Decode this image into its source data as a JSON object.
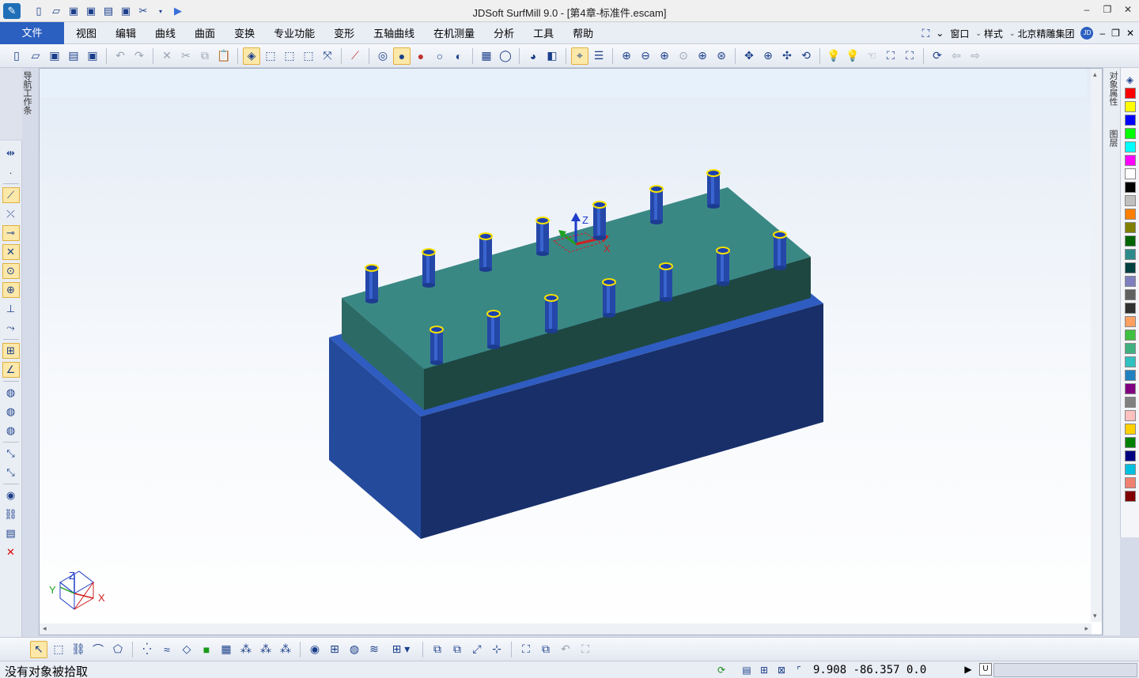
{
  "app": {
    "window_title": "JDSoft SurfMill 9.0 - [第4章-标准件.escam]"
  },
  "menu": {
    "file_label": "文件",
    "items": [
      "视图",
      "编辑",
      "曲线",
      "曲面",
      "变换",
      "专业功能",
      "变形",
      "五轴曲线",
      "在机测量",
      "分析",
      "工具",
      "帮助"
    ],
    "window_label": "窗口",
    "style_label": "样式",
    "company_label": "北京精雕集团",
    "user_badge": "JD"
  },
  "panels": {
    "nav_label": "导航工作条",
    "right_tab_properties": "对象属性",
    "right_tab_layers": "图层"
  },
  "viewport": {
    "axis_labels": {
      "x": "X",
      "y": "Y",
      "z": "Z"
    }
  },
  "palette": {
    "colors": [
      "#ff0000",
      "#ffff00",
      "#0000ff",
      "#00ff00",
      "#00ffff",
      "#ff00ff",
      "#ffffff",
      "#000000",
      "#c0c0c0",
      "#ff7f00",
      "#808000",
      "#006400",
      "#2e8b8b",
      "#004040",
      "#7f7fbf",
      "#606060",
      "#303030",
      "#ffa060",
      "#40c040",
      "#40b080",
      "#30c0c0",
      "#2080c0",
      "#800080",
      "#808080",
      "#ffc0c0",
      "#ffd000",
      "#008000",
      "#000080",
      "#00c0e0",
      "#f08070",
      "#800000"
    ]
  },
  "status": {
    "message": "没有对象被拾取",
    "coordinates": "9.908  -86.357  0.0",
    "u_label": "U"
  }
}
